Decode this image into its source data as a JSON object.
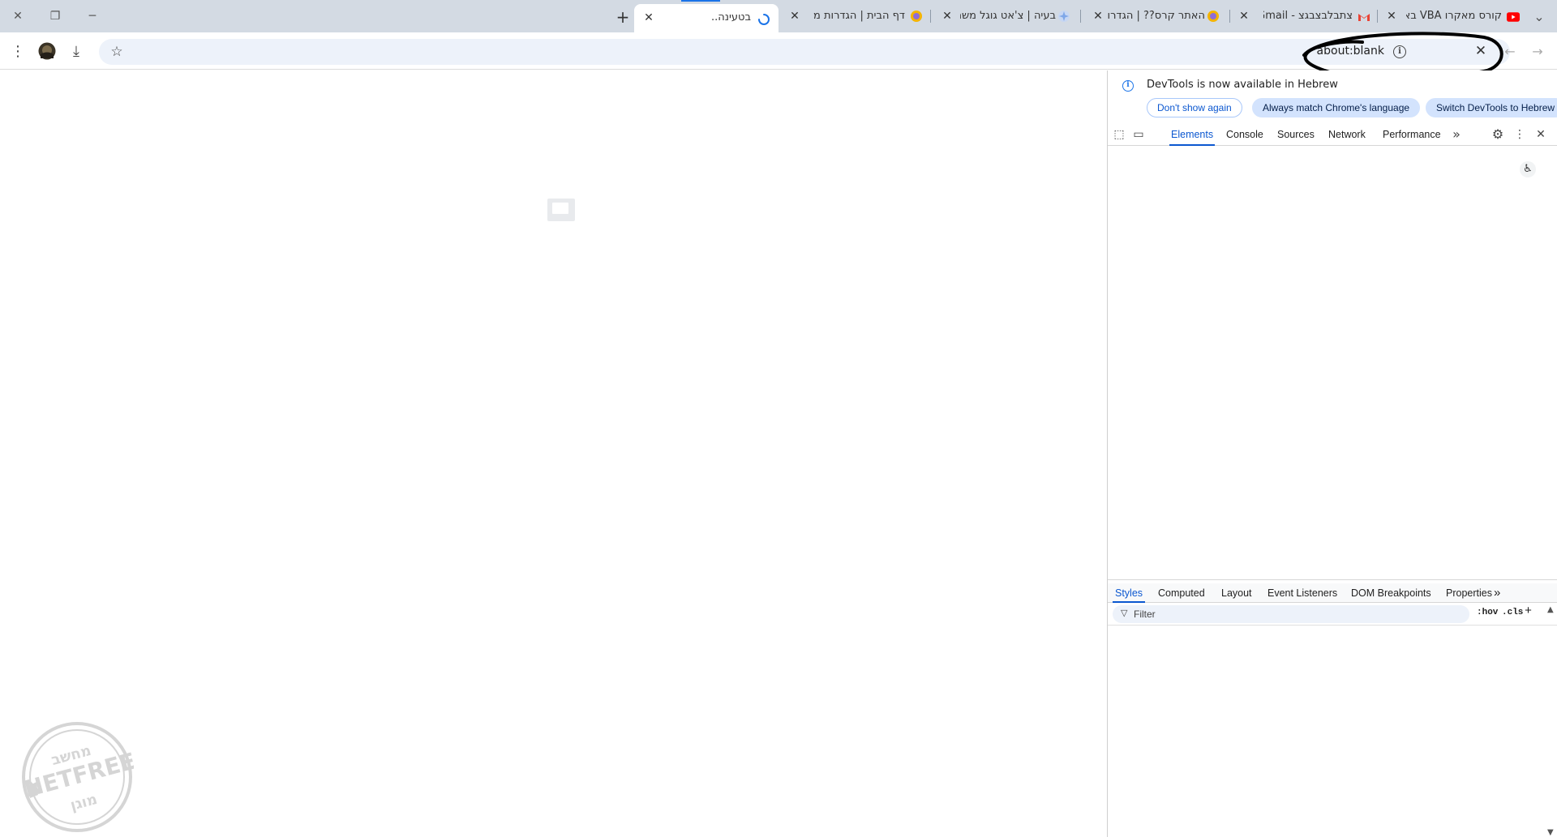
{
  "browser": {
    "window_controls": {
      "close": "✕",
      "restore": "❐",
      "minimize": "─",
      "tab_search": "⌄"
    },
    "tabs": [
      {
        "title": "קורס מאקרו VBA באקסל",
        "favicon": "youtube-icon",
        "active": false
      },
      {
        "title": "צתבלבצבגצ - Gmail",
        "favicon": "gmail-icon",
        "active": false
      },
      {
        "title": "האתר קרס?? | הגדרות",
        "favicon": "netfree-icon",
        "active": false
      },
      {
        "title": "בעיה | צ'אט גוגל משהו",
        "favicon": "gemini-icon",
        "active": false
      },
      {
        "title": "דף הבית | הגדרות מחשב",
        "favicon": "netfree-icon",
        "active": false
      },
      {
        "title": "בטעינה...",
        "favicon": "loading-spinner-icon",
        "active": true
      }
    ],
    "new_tab_label": "+",
    "tab_close_label": "✕",
    "address": {
      "url": "about:blank",
      "info_glyph": "i",
      "stop_glyph": "✕",
      "back_glyph": "←",
      "forward_glyph": "→"
    },
    "toolbar_glyphs": {
      "menu": "⋮",
      "download": "⤓",
      "bookmark": "☆"
    }
  },
  "devtools": {
    "infobar": {
      "message": "DevTools is now available in Hebrew",
      "buttons": [
        "Don't show again",
        "Always match Chrome's language",
        "Switch DevTools to Hebrew"
      ],
      "info_glyph": "i"
    },
    "main_tabs": [
      "Elements",
      "Console",
      "Sources",
      "Network",
      "Performance"
    ],
    "main_tabs_active": "Elements",
    "more_glyph": "»",
    "tool_glyphs": {
      "inspect": "⬚",
      "device": "▭",
      "settings": "⚙",
      "menu": "⋮",
      "close": "✕"
    },
    "accessibility_glyph": "♿",
    "sub_tabs": [
      "Styles",
      "Computed",
      "Layout",
      "Event Listeners",
      "DOM Breakpoints",
      "Properties"
    ],
    "sub_tabs_active": "Styles",
    "filter": {
      "placeholder": "Filter",
      "hov": ":hov",
      "cls": ".cls",
      "plus": "+"
    }
  },
  "watermark": {
    "line1": "מחשב",
    "line2": "NETFREE",
    "line3": "מוגן"
  },
  "colors": {
    "tabstrip": "#d3dae3",
    "accent": "#0b57d0",
    "omnibox": "#edf2fa"
  }
}
